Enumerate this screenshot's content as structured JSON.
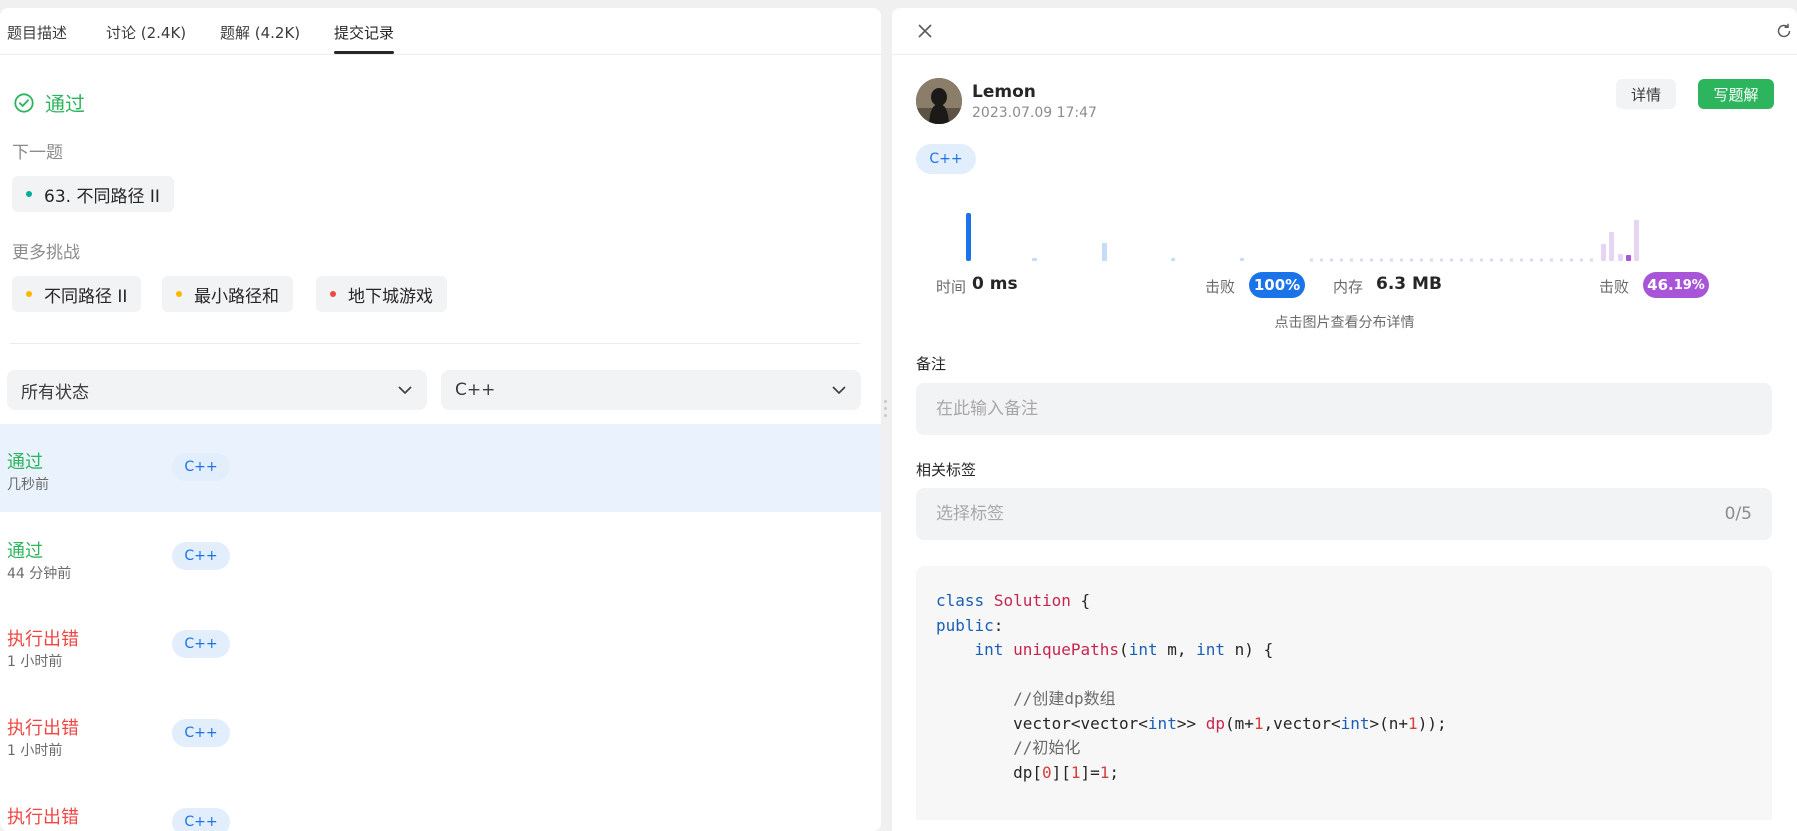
{
  "tabs": [
    "题目描述",
    "讨论 (2.4K)",
    "题解 (4.2K)",
    "提交记录"
  ],
  "result": {
    "status": "通过",
    "status_color": "#2db55d"
  },
  "next_problem": {
    "label": "下一题",
    "title": "63. 不同路径 II",
    "dot_color": "#00af9b"
  },
  "more_challenges": {
    "label": "更多挑战",
    "items": [
      {
        "title": "不同路径 II",
        "dot_color": "#ffb800"
      },
      {
        "title": "最小路径和",
        "dot_color": "#ffb800"
      },
      {
        "title": "地下城游戏",
        "dot_color": "#ef4743"
      }
    ]
  },
  "filters": {
    "status": "所有状态",
    "language": "C++"
  },
  "submissions": [
    {
      "status": "通过",
      "time": "几秒前",
      "lang": "C++",
      "kind": "ok"
    },
    {
      "status": "通过",
      "time": "44 分钟前",
      "lang": "C++",
      "kind": "ok"
    },
    {
      "status": "执行出错",
      "time": "1 小时前",
      "lang": "C++",
      "kind": "err"
    },
    {
      "status": "执行出错",
      "time": "1 小时前",
      "lang": "C++",
      "kind": "err"
    },
    {
      "status": "执行出错",
      "time": "",
      "lang": "C++",
      "kind": "err"
    }
  ],
  "detail": {
    "user": "Lemon",
    "date": "2023.07.09 17:47",
    "detail_button": "详情",
    "write_button": "写题解",
    "lang": "C++",
    "time_label": "时间",
    "time_value": "0 ms",
    "time_beat_label": "击败",
    "time_beat": "100%",
    "memory_label": "内存",
    "memory_value": "6.3 MB",
    "memory_beat_label": "击败",
    "memory_beat_int": "46.",
    "memory_beat_dec": "19%",
    "hint": "点击图片查看分布详情",
    "note_label": "备注",
    "note_placeholder": "在此输入备注",
    "tags_label": "相关标签",
    "tags_placeholder": "选择标签",
    "tags_count": "0/5",
    "time_color": "#1a73e8",
    "memory_color": "#a855d8"
  },
  "code_lines": [
    "class Solution {",
    "public:",
    "    int uniquePaths(int m, int n) {",
    "",
    "        //创建dp数组",
    "        vector<vector<int>> dp(m+1,vector<int>(n+1));",
    "        //初始化",
    "        dp[0][1]=1;"
  ]
}
